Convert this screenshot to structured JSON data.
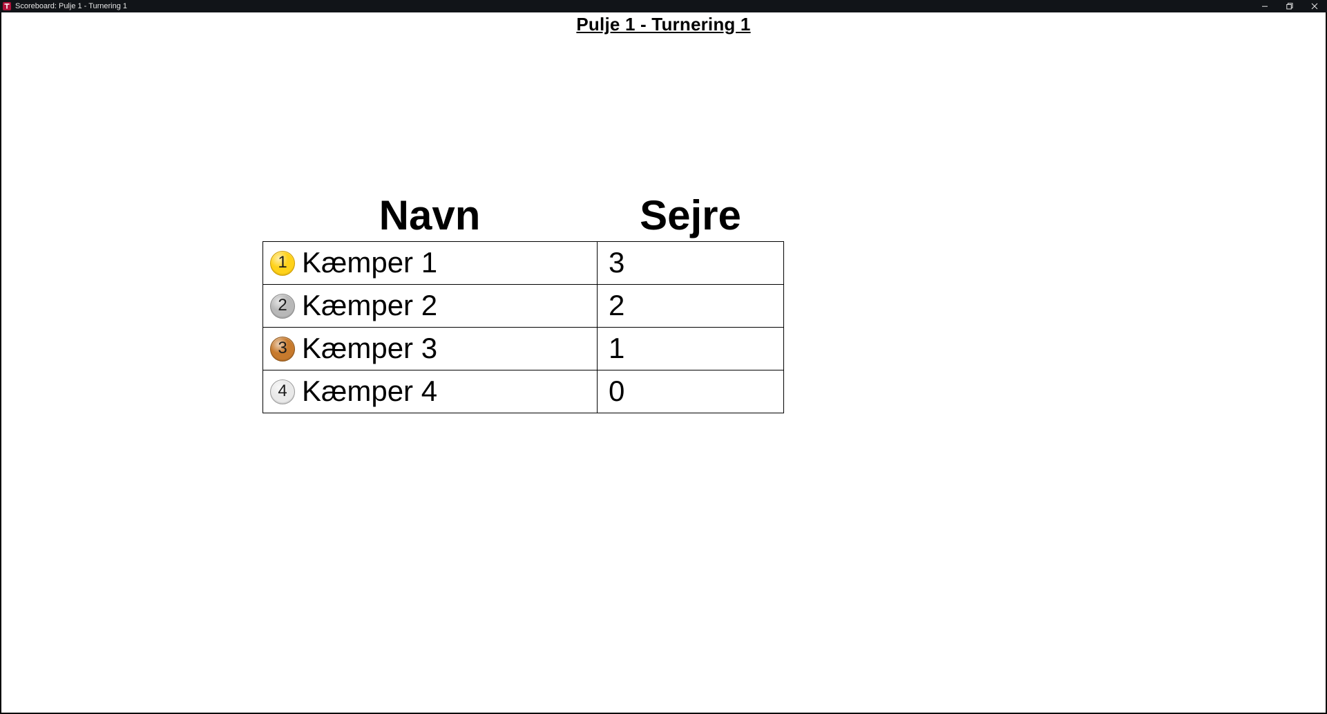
{
  "window": {
    "title": "Scoreboard: Pulje 1 - Turnering 1"
  },
  "page": {
    "title": "Pulje 1 - Turnering 1"
  },
  "table": {
    "headers": {
      "name": "Navn",
      "wins": "Sejre"
    },
    "rows": [
      {
        "rank": "1",
        "name": "Kæmper 1",
        "wins": "3",
        "medal_color": "#ffd21a",
        "medal_edge": "#cf9b00"
      },
      {
        "rank": "2",
        "name": "Kæmper 2",
        "wins": "2",
        "medal_color": "#b8b8b8",
        "medal_edge": "#8a8a8a"
      },
      {
        "rank": "3",
        "name": "Kæmper 3",
        "wins": "1",
        "medal_color": "#c77a2d",
        "medal_edge": "#8c5418"
      },
      {
        "rank": "4",
        "name": "Kæmper 4",
        "wins": "0",
        "medal_color": "#e9e9e9",
        "medal_edge": "#9a9a9a"
      }
    ]
  }
}
